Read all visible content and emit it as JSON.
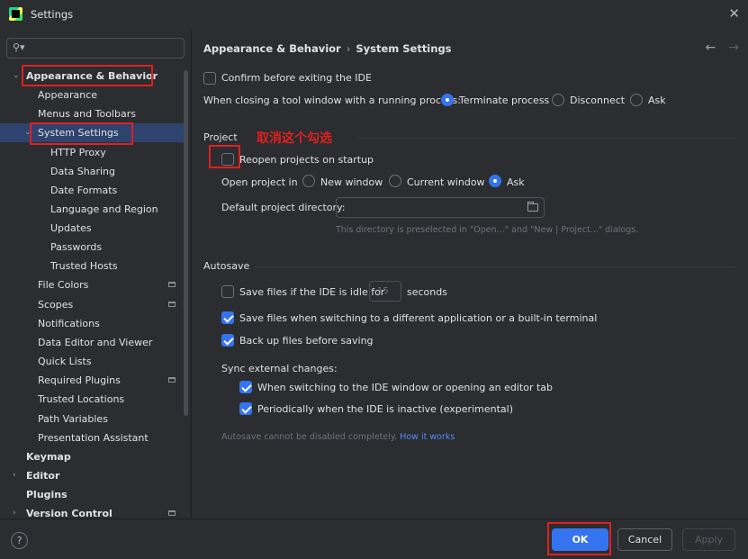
{
  "window": {
    "title": "Settings",
    "close_glyph": "✕"
  },
  "search": {
    "placeholder": "",
    "value": "",
    "icon": "search-icon"
  },
  "sidebar": {
    "items": [
      {
        "label": "Appearance & Behavior",
        "bold": true,
        "expanded": true
      },
      {
        "label": "Appearance"
      },
      {
        "label": "Menus and Toolbars"
      },
      {
        "label": "System Settings",
        "expanded": true,
        "selected": true
      },
      {
        "label": "HTTP Proxy"
      },
      {
        "label": "Data Sharing"
      },
      {
        "label": "Date Formats"
      },
      {
        "label": "Language and Region"
      },
      {
        "label": "Updates"
      },
      {
        "label": "Passwords"
      },
      {
        "label": "Trusted Hosts"
      },
      {
        "label": "File Colors",
        "project_scope": true
      },
      {
        "label": "Scopes",
        "project_scope": true
      },
      {
        "label": "Notifications"
      },
      {
        "label": "Data Editor and Viewer"
      },
      {
        "label": "Quick Lists"
      },
      {
        "label": "Required Plugins",
        "project_scope": true
      },
      {
        "label": "Trusted Locations"
      },
      {
        "label": "Path Variables"
      },
      {
        "label": "Presentation Assistant"
      },
      {
        "label": "Keymap",
        "bold": true
      },
      {
        "label": "Editor",
        "bold": true,
        "collapsed": true
      },
      {
        "label": "Plugins",
        "bold": true
      },
      {
        "label": "Version Control",
        "bold": true,
        "collapsed": true,
        "project_scope": true
      }
    ]
  },
  "breadcrumb": {
    "parent": "Appearance & Behavior",
    "separator": "›",
    "current": "System Settings"
  },
  "nav": {
    "back": "←",
    "forward": "→"
  },
  "general": {
    "confirm_exit": {
      "label": "Confirm before exiting the IDE",
      "checked": false
    },
    "closing_label": "When closing a tool window with a running process:",
    "closing_options": [
      {
        "label": "Terminate process",
        "selected": true
      },
      {
        "label": "Disconnect",
        "selected": false
      },
      {
        "label": "Ask",
        "selected": false
      }
    ]
  },
  "project": {
    "title": "Project",
    "annotation": "取消这个勾选",
    "reopen": {
      "label": "Reopen projects on startup",
      "checked": false
    },
    "open_in_label": "Open project in",
    "open_in_options": [
      {
        "label": "New window",
        "selected": false
      },
      {
        "label": "Current window",
        "selected": false
      },
      {
        "label": "Ask",
        "selected": true
      }
    ],
    "default_dir_label": "Default project directory:",
    "default_dir_value": "",
    "default_dir_hint": "This directory is preselected in \"Open...\" and \"New | Project...\" dialogs."
  },
  "autosave": {
    "title": "Autosave",
    "idle": {
      "label": "Save files if the IDE is idle for",
      "checked": false,
      "value": "15",
      "unit": "seconds"
    },
    "switching": {
      "label": "Save files when switching to a different application or a built-in terminal",
      "checked": true
    },
    "backup": {
      "label": "Back up files before saving",
      "checked": true
    },
    "sync_label": "Sync external changes:",
    "sync_switch": {
      "label": "When switching to the IDE window or opening an editor tab",
      "checked": true
    },
    "sync_periodic": {
      "label": "Periodically when the IDE is inactive (experimental)",
      "checked": true
    },
    "note": "Autosave cannot be disabled completely.",
    "note_link": "How it works"
  },
  "footer": {
    "help": "?",
    "ok": "OK",
    "cancel": "Cancel",
    "apply": "Apply"
  },
  "colors": {
    "accent": "#3574f0",
    "annotation_red": "#e02020",
    "background": "#2b2d30",
    "selection": "#2e436e"
  }
}
